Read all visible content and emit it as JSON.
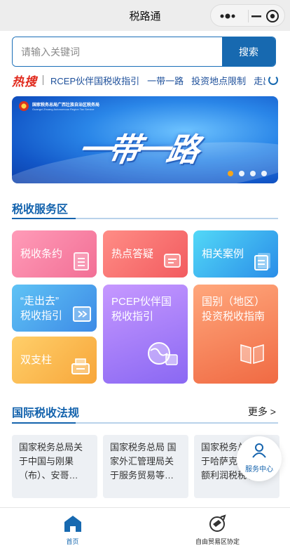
{
  "window": {
    "title": "税路通"
  },
  "capsule": {
    "more_icon": "more-dots-icon",
    "close_icon": "close-miniprogram-icon"
  },
  "search": {
    "placeholder": "请输入关键词",
    "button_label": "搜索"
  },
  "hot_search": {
    "logo_text": "热搜",
    "terms": [
      "RCEP伙伴国税收指引",
      "一带一路",
      "投资地点限制",
      "走出去"
    ],
    "refresh_icon": "refresh-icon"
  },
  "banner": {
    "org_name_cn": "国家税务总局广西壮族自治区税务局",
    "org_name_en": "Guangxi Zhuang Autonomous Region Tax Service",
    "headline": "一带一路",
    "slides_total": 4,
    "active_slide": 1
  },
  "tax_service": {
    "title": "税收服务区",
    "tiles": [
      {
        "label": "税收条约",
        "icon": "document-icon"
      },
      {
        "label": "热点答疑",
        "icon": "chat-card-icon"
      },
      {
        "label": "相关案例",
        "icon": "case-list-icon"
      },
      {
        "label_line1": "“走出去”",
        "label_line2": "税收指引",
        "icon": "guide-arrow-icon"
      },
      {
        "label_line1": "PCEP伙伴国",
        "label_line2": "税收指引",
        "icon": "globe-doc-icon"
      },
      {
        "label_line1": "国别（地区）",
        "label_line2": "投资税收指南",
        "icon": "book-icon"
      },
      {
        "label": "双支柱",
        "icon": "printer-icon"
      }
    ]
  },
  "intl_law": {
    "title": "国际税收法规",
    "more_label": "更多 >",
    "cards": [
      {
        "text": "国家税务总局关于中国与刚果（布）、安哥…"
      },
      {
        "text": "国家税务总局 国家外汇管理局关于服务贸易等…"
      },
      {
        "text": "国家税务总局关于哈萨克斯坦…额利润税税收…"
      }
    ]
  },
  "service_center": {
    "label": "服务中心",
    "icon": "service-person-icon"
  },
  "tabbar": {
    "tabs": [
      {
        "label": "首页",
        "icon": "home-icon",
        "active": true
      },
      {
        "label": "自由贸易区协定",
        "icon": "globe-rocket-icon",
        "active": false
      }
    ],
    "active_color": "#1769b0"
  },
  "colors": {
    "brand_blue": "#1769b0",
    "hot_red": "#e0281b",
    "accent_orange": "#f4a51a"
  }
}
